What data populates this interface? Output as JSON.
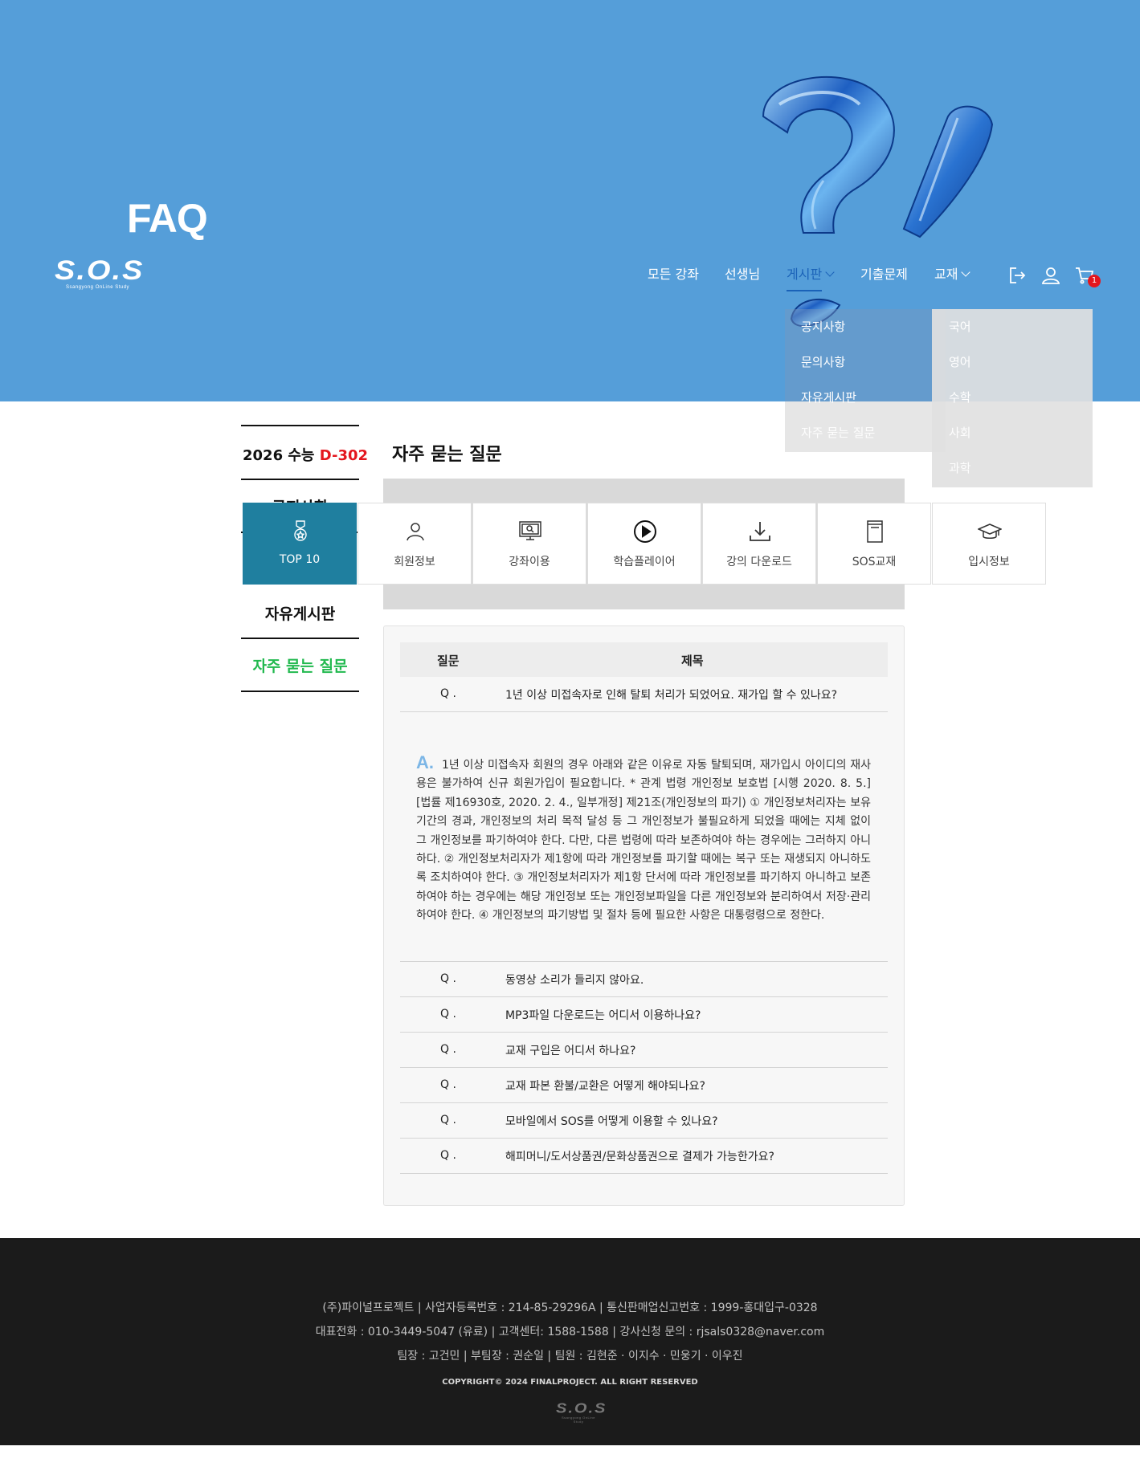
{
  "hero": {
    "title": "FAQ"
  },
  "brand": {
    "logo": "S.O.S",
    "tagline": "Ssangyong OnLine Study"
  },
  "nav": {
    "items": [
      "모든 강좌",
      "선생님",
      "게시판",
      "기출문제",
      "교재"
    ],
    "active": "게시판",
    "icons": [
      "logout-icon",
      "user-icon",
      "cart-icon"
    ],
    "cart_count": "1"
  },
  "board_menu": [
    "공지사항",
    "문의사항",
    "자유게시판",
    "자주 묻는 질문"
  ],
  "book_menu": [
    "국어",
    "영어",
    "수학",
    "사회",
    "과학"
  ],
  "sidebar": {
    "dday_prefix": "2026 수능",
    "dday_value": "D-302",
    "clipped_item": "공지사항",
    "items": [
      "자유게시판",
      "자주 묻는 질문"
    ]
  },
  "main": {
    "heading": "자주 묻는 질문",
    "categories": [
      {
        "label": "TOP 10",
        "icon": "medal-icon"
      },
      {
        "label": "회원정보",
        "icon": "user-icon"
      },
      {
        "label": "강좌이용",
        "icon": "monitor-search-icon"
      },
      {
        "label": "학습플레이어",
        "icon": "play-icon"
      },
      {
        "label": "강의 다운로드",
        "icon": "download-icon"
      },
      {
        "label": "SOS교재",
        "icon": "book-icon"
      },
      {
        "label": "입시정보",
        "icon": "graduation-cap-icon"
      }
    ],
    "table_head": {
      "question": "질문",
      "title": "제목"
    },
    "q_marker": "Q .",
    "first_question": "1년 이상 미접속자로 인해 탈퇴 처리가 되었어요. 재가입 할 수 있나요?",
    "answer_marker": "A.",
    "answer": "1년 이상 미접속자 회원의 경우 아래와 같은 이유로 자동 탈퇴되며, 재가입시 아이디의 재사용은 불가하여 신규 회원가입이 필요합니다. * 관계 법령 개인정보 보호법 [시행 2020. 8. 5.] [법률 제16930호, 2020. 2. 4., 일부개정] 제21조(개인정보의 파기) ① 개인정보처리자는 보유기간의 경과, 개인정보의 처리 목적 달성 등 그 개인정보가 불필요하게 되었을 때에는 지체 없이 그 개인정보를 파기하여야 한다. 다만, 다른 법령에 따라 보존하여야 하는 경우에는 그러하지 아니하다. ② 개인정보처리자가 제1항에 따라 개인정보를 파기할 때에는 복구 또는 재생되지 아니하도록 조치하여야 한다. ③ 개인정보처리자가 제1항 단서에 따라 개인정보를 파기하지 아니하고 보존하여야 하는 경우에는 해당 개인정보 또는 개인정보파일을 다른 개인정보와 분리하여서 저장·관리하여야 한다. ④ 개인정보의 파기방법 및 절차 등에 필요한 사항은 대통령령으로 정한다.",
    "questions": [
      "동영상 소리가 들리지 않아요.",
      "MP3파일 다운로드는 어디서 이용하나요?",
      "교재 구입은 어디서 하나요?",
      "교재 파본 환불/교환은 어떻게 해야되나요?",
      "모바일에서 SOS를 어떻게 이용할 수 있나요?",
      "해피머니/도서상품권/문화상품권으로 결제가 가능한가요?"
    ]
  },
  "footer": {
    "line1": "(주)파이널프로젝트 | 사업자등록번호 : 214-85-29296A | 통신판매업신고번호 : 1999-홍대입구-0328",
    "line2": "대표전화 : 010-3449-5047 (유료) | 고객센터: 1588-1588 | 강사신청 문의 : rjsals0328@naver.com",
    "line3": "팀장 : 고건민  |  부팀장 : 권순일  |  팀원 : 김현준 · 이지수 · 민웅기 · 이우진",
    "copyright": "COPYRIGHT© 2024 FINALPROJECT. ALL RIGHT RESERVED"
  },
  "colors": {
    "hero_bg": "#559ed9",
    "active_nav": "#1a62b8",
    "dday_red": "#e4161e",
    "sidebar_green": "#22b94f",
    "category_active": "#1f7f9f",
    "footer_bg": "#1b1b1b"
  }
}
